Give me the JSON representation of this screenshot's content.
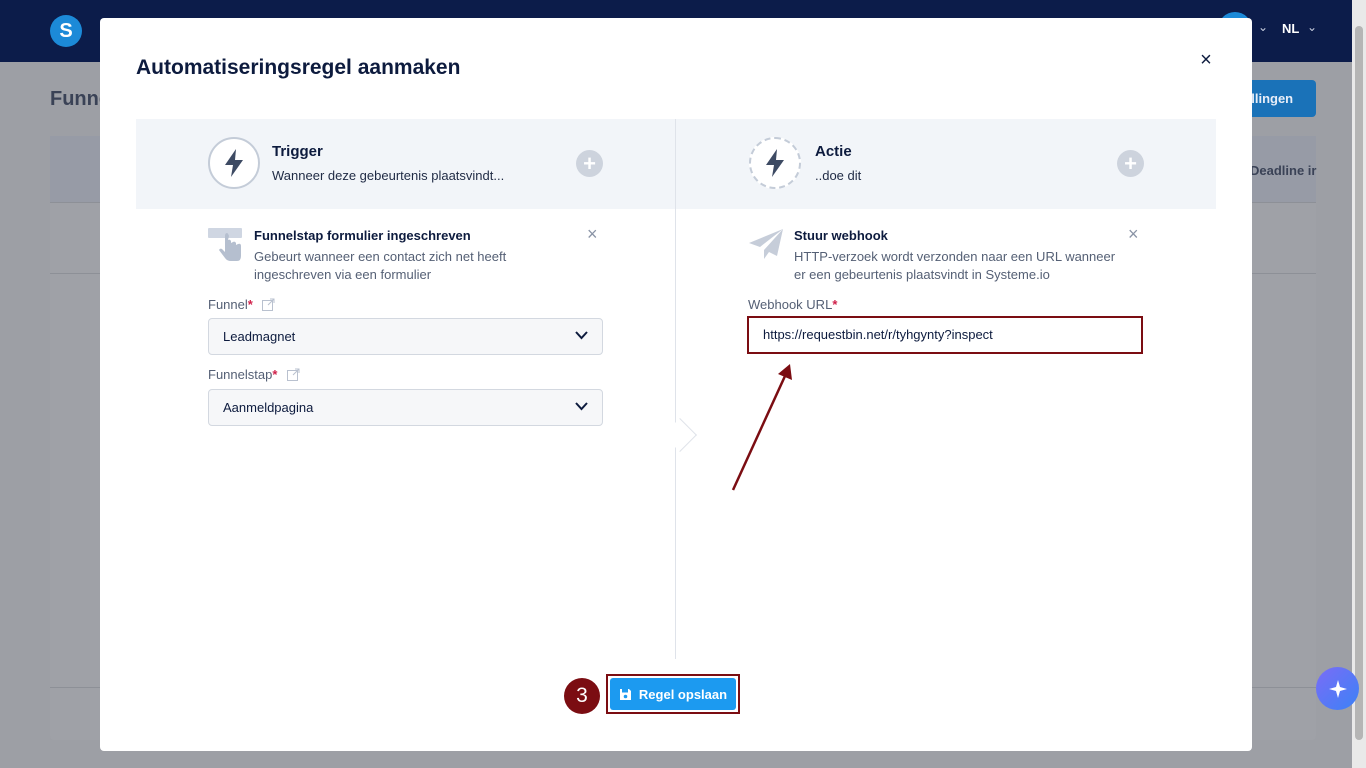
{
  "background": {
    "logo_letter": "S",
    "language": "NL",
    "page_title": "Funne",
    "settings_button": "ellingen",
    "deadline_col": "Deadline ir"
  },
  "modal": {
    "title": "Automatiseringsregel aanmaken",
    "close": "×",
    "trigger": {
      "title": "Trigger",
      "subtitle": "Wanneer deze gebeurtenis plaatsvindt..."
    },
    "action": {
      "title": "Actie",
      "subtitle": "..doe dit"
    },
    "trigger_card": {
      "title": "Funnelstap formulier ingeschreven",
      "desc_line1": "Gebeurt wanneer een contact zich net heeft",
      "desc_line2": "ingeschreven via een formulier"
    },
    "funnel_field": {
      "label": "Funnel",
      "required": "*",
      "value": "Leadmagnet"
    },
    "funnelstep_field": {
      "label": "Funnelstap",
      "required": "*",
      "value": "Aanmeldpagina"
    },
    "action_card": {
      "title": "Stuur webhook",
      "desc_line1": "HTTP-verzoek wordt verzonden naar een URL wanneer",
      "desc_line2": "er een gebeurtenis plaatsvindt in Systeme.io"
    },
    "webhook_field": {
      "label": "Webhook URL",
      "required": "*",
      "value": "https://requestbin.net/r/tyhgynty?inspect"
    },
    "save_button": "Regel opslaan",
    "step_badge": "3"
  },
  "colors": {
    "accent": "#1c9af0",
    "annotation": "#7b0d12",
    "topbar": "#0c1c4a"
  }
}
